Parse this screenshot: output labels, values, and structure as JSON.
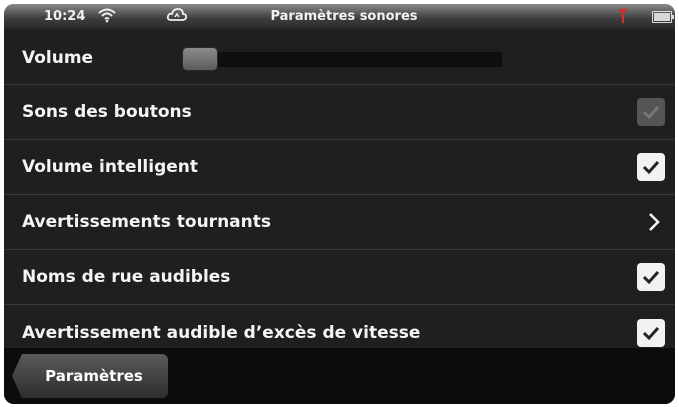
{
  "status_bar": {
    "time": "10:24",
    "title": "Paramètres sonores",
    "icons": [
      "wifi-icon",
      "cloud-icon",
      "gps-icon",
      "battery-icon"
    ]
  },
  "rows": [
    {
      "label": "Volume",
      "control": "slider",
      "level": 0.02
    },
    {
      "label": "Sons des boutons",
      "control": "checkbox",
      "checked": true,
      "disabled": true
    },
    {
      "label": "Volume intelligent",
      "control": "checkbox",
      "checked": true
    },
    {
      "label": "Avertissements tournants",
      "control": "chevron"
    },
    {
      "label": "Noms de rue audibles",
      "control": "checkbox",
      "checked": true
    },
    {
      "label": "Avertissement audible d’excès de vitesse",
      "control": "checkbox",
      "checked": true
    }
  ],
  "bottom_bar": {
    "back_label": "Paramètres"
  },
  "colors": {
    "background": "#1f1f1f",
    "text": "#f4f4f4",
    "checkbox": "#f2f2f2",
    "gps_marker": "#d0302a"
  }
}
